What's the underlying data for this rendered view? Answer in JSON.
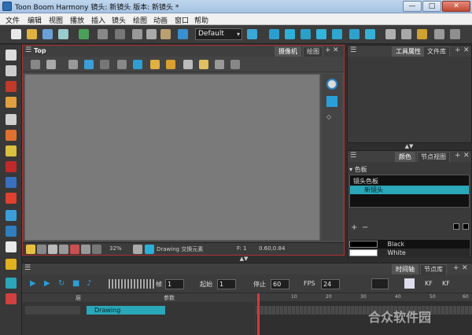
{
  "window": {
    "title": "Toon Boom Harmony 镜头: 新镜头 版本: 新镜头 *",
    "minimize": "—",
    "maximize": "□",
    "close": "✕"
  },
  "menu": [
    "文件",
    "编辑",
    "视图",
    "播放",
    "插入",
    "镜头",
    "绘图",
    "动画",
    "窗口",
    "帮助"
  ],
  "toolbar": {
    "preset_value": "Default",
    "preset_arrow": "▾"
  },
  "camera_panel": {
    "title": "Top",
    "tabs": [
      "摄像机",
      "绘图"
    ],
    "status": {
      "zoom": "32%",
      "layer_info": "Drawing 交换元素",
      "frame": "F: 1",
      "coords": "0.60,0.84"
    }
  },
  "tool_panel": {
    "tabs": [
      "工具属性",
      "文件库"
    ]
  },
  "color_panel": {
    "tabs": [
      "颜色",
      "节点视图"
    ],
    "palette_header": "色板",
    "palette_group": "镜头色板",
    "palette_item": "新镜头",
    "swatches": [
      {
        "name": "Black",
        "color": "#000000"
      },
      {
        "name": "White",
        "color": "#ffffff"
      }
    ]
  },
  "timeline": {
    "tabs": [
      "时间轴",
      "节点库"
    ],
    "frame_label": "帧",
    "frame_value": "1",
    "start_label": "起始",
    "start_value": "1",
    "stop_label": "停止",
    "stop_value": "60",
    "fps_label": "FPS",
    "fps_value": "24",
    "layer_column": "层",
    "params_column": "参数",
    "layer_name": "Drawing",
    "ruler_ticks": [
      "10",
      "20",
      "30",
      "40",
      "50",
      "60"
    ],
    "kf_label": "KF"
  },
  "watermark": "合众软件园",
  "colors": {
    "selection_cyan": "#2aa7b8",
    "panel_border_red": "#b03030",
    "playhead_red": "#d23a3a"
  }
}
